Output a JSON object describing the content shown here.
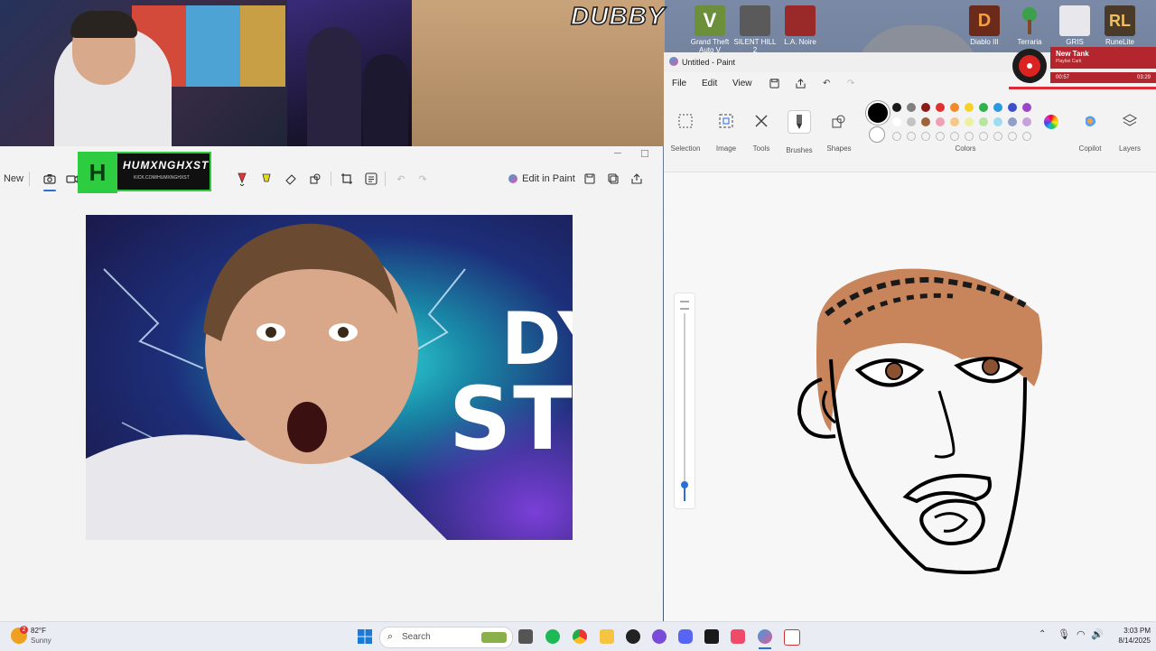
{
  "desktop": {
    "overlay_text": "DUBBY",
    "icons": [
      {
        "label": "Grand Theft Auto V",
        "color": "#6b8f3b"
      },
      {
        "label": "SILENT HILL 2",
        "color": "#5a5a5a"
      },
      {
        "label": "L.A. Noire",
        "color": "#9a2a2a"
      },
      {
        "label": "Diablo III",
        "color": "#6b2a1a"
      },
      {
        "label": "Terraria",
        "color": "#3b8f4b"
      },
      {
        "label": "GRIS",
        "color": "#e8e8ec"
      },
      {
        "label": "RuneLite",
        "color": "#4a3a2a"
      }
    ]
  },
  "stream_badge": {
    "logo": "H",
    "name": "HUMXNGHXST",
    "url": "KICK.COM/HUMXNGHXST"
  },
  "snipping_tool": {
    "toolbar": {
      "new_label": "New",
      "edit_in_paint_label": "Edit in Paint"
    },
    "screenshot_text": {
      "line1": "DY",
      "line2": "ST"
    }
  },
  "paint": {
    "title": "Untitled - Paint",
    "menu": [
      "File",
      "Edit",
      "View"
    ],
    "ribbon": {
      "selection": "Selection",
      "image": "Image",
      "tools": "Tools",
      "brushes": "Brushes",
      "shapes": "Shapes",
      "colors": "Colors",
      "copilot": "Copilot",
      "layers": "Layers"
    },
    "palette_row1": [
      "#1a1a1a",
      "#7f7f7f",
      "#8b1a1a",
      "#e0302f",
      "#f08a2a",
      "#f5d22a",
      "#2fb24a",
      "#2a9ae0",
      "#3b4fc8",
      "#9b46c8"
    ],
    "palette_row2": [
      "#ffffff",
      "#c3c3c3",
      "#a0623a",
      "#f0a0b4",
      "#f5c88a",
      "#eef0a0",
      "#b8e6a0",
      "#a0dcf0",
      "#8fa0c8",
      "#c8a0dc"
    ],
    "selected_color": "#000000"
  },
  "now_playing": {
    "title": "New Tank",
    "artist": "Playboi Carti",
    "elapsed": "00:57",
    "duration": "03:29"
  },
  "taskbar": {
    "weather_temp": "82°F",
    "weather_desc": "Sunny",
    "weather_badge": "2",
    "search_placeholder": "Search",
    "time": "3:03 PM",
    "date": "8/14/2025"
  }
}
